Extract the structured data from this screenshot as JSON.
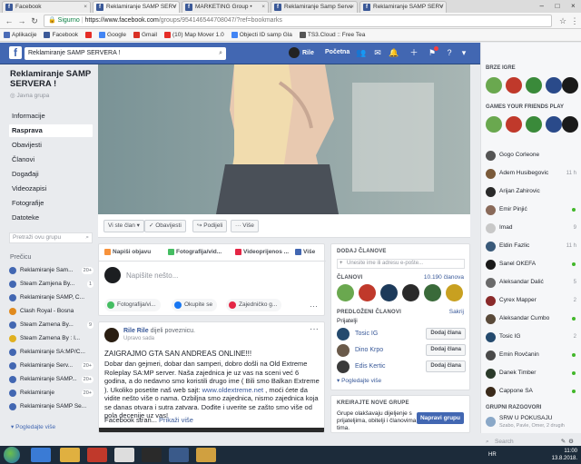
{
  "browser": {
    "tabs": [
      {
        "label": "Facebook",
        "active": false
      },
      {
        "label": "Reklamiranje SAMP SERV",
        "active": true
      },
      {
        "label": "MARKETING Group •",
        "active": false
      },
      {
        "label": "Reklamiranje Samp Serve",
        "active": false
      },
      {
        "label": "Reklamiranje SAMP SERV",
        "active": false
      }
    ],
    "secure_label": "Sigurno",
    "url_host": "https://www.facebook.com",
    "url_path": "/groups/954146544708047/?ref=bookmarks",
    "bookmarks": [
      {
        "label": "Aplikacije",
        "color": "#4b6cb7"
      },
      {
        "label": "Facebook",
        "color": "#3b5998"
      },
      {
        "label": "",
        "color": "#e52d27"
      },
      {
        "label": "Google",
        "color": "#4285f4"
      },
      {
        "label": "Gmail",
        "color": "#d93025"
      },
      {
        "label": "(10) Map Mover 1.0",
        "color": "#e52d27"
      },
      {
        "label": "Objecti ID samp Gla",
        "color": "#4285f4"
      },
      {
        "label": "TS3.Cloud :: Free Tea",
        "color": "#555555"
      }
    ]
  },
  "fb": {
    "search_value": "Reklamiranje SAMP SERVERA !",
    "user_name": "Rile",
    "home_label": "Početna"
  },
  "group": {
    "title": "Reklamiranje SAMP SERVERA !",
    "type": "Javna grupa",
    "nav": [
      {
        "label": "Informacije",
        "active": false
      },
      {
        "label": "Rasprava",
        "active": true
      },
      {
        "label": "Obavijesti",
        "active": false
      },
      {
        "label": "Članovi",
        "active": false
      },
      {
        "label": "Događaji",
        "active": false
      },
      {
        "label": "Videozapisi",
        "active": false
      },
      {
        "label": "Fotografije",
        "active": false
      },
      {
        "label": "Datoteke",
        "active": false
      }
    ],
    "search_placeholder": "Pretraži ovu grupu",
    "recent_label": "Prečicu",
    "recent": [
      {
        "label": "Reklamiranje Sam...",
        "count": "20+"
      },
      {
        "label": "Steam Zamjena By...",
        "count": "1"
      },
      {
        "label": "Reklamiranje SAMP, C...",
        "count": ""
      },
      {
        "label": "Clash Royal - Bosna",
        "count": ""
      },
      {
        "label": "Steam Zamena By...",
        "count": "9"
      },
      {
        "label": "Steam Zamena By : l...",
        "count": ""
      },
      {
        "label": "Reklamiranje SA:MP/C...",
        "count": ""
      },
      {
        "label": "Reklamiranje Serv...",
        "count": "20+"
      },
      {
        "label": "Reklamiranje SAMP...",
        "count": "20+"
      },
      {
        "label": "Reklamiranje",
        "count": "20+"
      },
      {
        "label": "Reklamiranje SAMP Se...",
        "count": ""
      }
    ],
    "see_more": "Pogledajte više"
  },
  "cover_actions": {
    "member": "Vi ste član ▾",
    "notifications": "✓ Obavijesti",
    "share": "Podijeli",
    "more": "··· Više"
  },
  "composer": {
    "tabs": [
      "Napiši objavu",
      "Fotografija/vid...",
      "Videoprijenos ...",
      "Više"
    ],
    "placeholder": "Napišite nešto...",
    "pills": [
      "Fotografija/vi...",
      "Okupite se",
      "Zajedničko g..."
    ]
  },
  "post": {
    "author": "Rile Rile",
    "verb": "dijeli poveznicu.",
    "time": "Upravo sada",
    "headline": "ZAIGRAJMO GTA SAN ANDREAS ONLINE!!!",
    "body_part1": "Dobar dan gejmeri, dobar dan samperi, dobro došli na Old Extreme Roleplay SA:MP server. Naša zajednica je uz vas na sceni već 6 godina, a do nedavno smo koristili drugo ime ( Bili smo Balkan Extreme ). Ukoliko posetite naš web sajt: ",
    "body_link": "www.oldextreme.net",
    "body_part2": " , moći ćete da vidite nešto više o nama. Ozbiljna smo zajednica, nismo zajednica koja se danas otvara i sutra zatvara. Dođite i uverite se zašto smo više od pola decenije uz vas!",
    "more_text": "Facebook stran...",
    "more_link": "Prikaži više"
  },
  "members": {
    "add_header": "DODAJ ČLANOVE",
    "add_placeholder": "Unesite ime ili adresu e-pošte...",
    "members_header": "ČLANOVI",
    "count": "10.190 članova",
    "suggested_header": "PREDLOŽENI ČLANOVI",
    "hide": "Sakrij",
    "friends_label": "Prijatelji",
    "suggested": [
      {
        "name": "Tosic IG",
        "button": "Dodaj člana"
      },
      {
        "name": "Dino Krpo",
        "button": "Dodaj člana"
      },
      {
        "name": "Edis Kertic",
        "button": "Dodaj člana"
      }
    ],
    "see_less": "▾ Pogledajte više"
  },
  "create": {
    "header": "KREIRAJTE NOVE GRUPE",
    "text": "Grupe olakšavaju dijeljenje s prijateljima, obitelji i članovima tima.",
    "button": "Napravi grupu"
  },
  "chat": {
    "quick_games": "BRZE IGRE",
    "friends_play": "GAMES YOUR FRIENDS PLAY",
    "contacts": [
      {
        "name": "Gogo Corleone",
        "status": "",
        "online": false,
        "color": "#555555"
      },
      {
        "name": "Adem Husibegovic",
        "status": "11 h",
        "online": false,
        "color": "#7a5a3a"
      },
      {
        "name": "Arijan Zahirovic",
        "status": "",
        "online": false,
        "color": "#2a2a2a"
      },
      {
        "name": "Emir Pinjić",
        "status": "",
        "online": true,
        "color": "#8a6a5a"
      },
      {
        "name": "Imad",
        "status": "9",
        "online": false,
        "color": "#c8c8c8"
      },
      {
        "name": "Eldin Fazlic",
        "status": "11 h",
        "online": false,
        "color": "#3a5a7a"
      },
      {
        "name": "Sanel OKEFA",
        "status": "",
        "online": true,
        "color": "#1a1a1a"
      },
      {
        "name": "Aleksandar Dalić",
        "status": "5",
        "online": false,
        "color": "#6a6a6a"
      },
      {
        "name": "Cyrex Mapper",
        "status": "2",
        "online": false,
        "color": "#8a2a2a"
      },
      {
        "name": "Aleksandar Cumbo",
        "status": "",
        "online": true,
        "color": "#5a4a3a"
      },
      {
        "name": "Tosic IG",
        "status": "2",
        "online": false,
        "color": "#244a6e"
      },
      {
        "name": "Emin Rovčanin",
        "status": "",
        "online": true,
        "color": "#4a4a4a"
      },
      {
        "name": "Danek Timber",
        "status": "",
        "online": true,
        "color": "#2a3a2a"
      },
      {
        "name": "Cappone SA",
        "status": "",
        "online": true,
        "color": "#3a2a1a"
      }
    ],
    "groups_header": "GRUPNI RAZGOVORI",
    "group_name": "SRW U POKUSAJU",
    "group_members": "Szabo, Pavle, Omer, 2 drugih",
    "search": "Search"
  },
  "taskbar": {
    "lang": "HR",
    "time": "11:00",
    "date": "13.8.2018."
  }
}
